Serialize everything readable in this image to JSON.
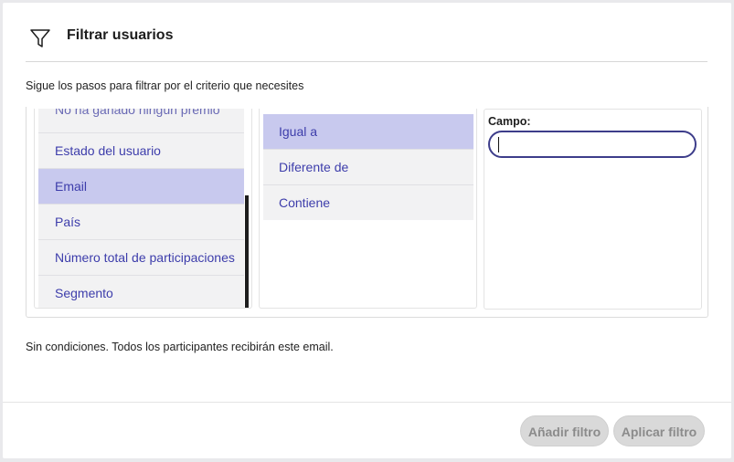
{
  "header": {
    "title": "Filtrar usuarios",
    "icon": "filter-icon"
  },
  "description": "Sigue los pasos para filtrar por el criterio que necesites",
  "criteria": {
    "items": [
      {
        "label": "No ha ganado ningún premio",
        "partial": true
      },
      {
        "label": "Estado del usuario"
      },
      {
        "label": "Email",
        "selected": true
      },
      {
        "label": "País"
      },
      {
        "label": "Número total de participaciones"
      },
      {
        "label": "Segmento"
      }
    ]
  },
  "operators": {
    "items": [
      {
        "label": "Igual a",
        "selected": true
      },
      {
        "label": "Diferente de"
      },
      {
        "label": "Contiene"
      }
    ]
  },
  "value_field": {
    "label": "Campo:",
    "value": ""
  },
  "status": "Sin condiciones. Todos los participantes recibirán este email.",
  "footer": {
    "add_label": "Añadir filtro",
    "apply_label": "Aplicar filtro"
  },
  "colors": {
    "accent": "#3d3dab",
    "selected_bg": "#c8c9ee",
    "input_border": "#3d3d8a",
    "disabled_btn": "#d9d9d9"
  }
}
